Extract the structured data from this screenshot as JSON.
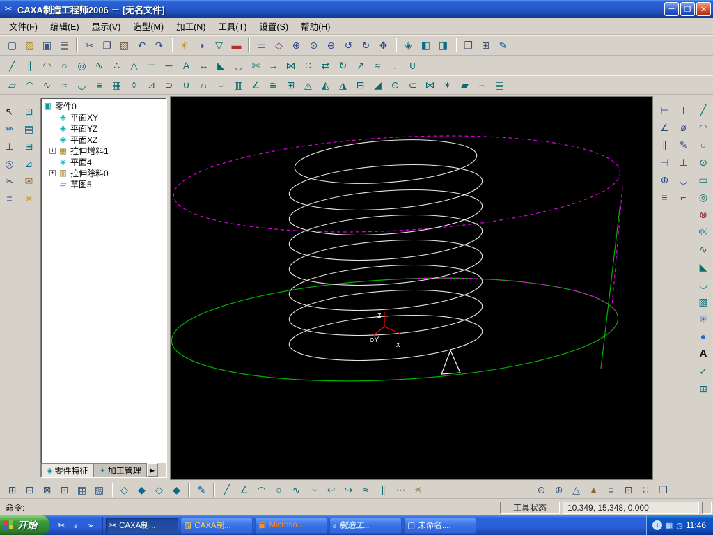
{
  "window": {
    "title": "CAXA制造工程师2006  －  [无名文件]",
    "app_icon": "✂",
    "controls": {
      "minimize": "─",
      "restore": "❐",
      "close": "✕"
    }
  },
  "menu": {
    "items": [
      {
        "name": "menu-file",
        "label": "文件(F)"
      },
      {
        "name": "menu-edit",
        "label": "编辑(E)"
      },
      {
        "name": "menu-view",
        "label": "显示(V)"
      },
      {
        "name": "menu-model",
        "label": "造型(M)"
      },
      {
        "name": "menu-machining",
        "label": "加工(N)"
      },
      {
        "name": "menu-tools",
        "label": "工具(T)"
      },
      {
        "name": "menu-settings",
        "label": "设置(S)"
      },
      {
        "name": "menu-help",
        "label": "帮助(H)"
      }
    ]
  },
  "toolbars": {
    "standard": [
      {
        "name": "new-icon",
        "g": "▢",
        "c": "#35567a"
      },
      {
        "name": "open-icon",
        "g": "▨",
        "c": "#a8802a"
      },
      {
        "name": "save-icon",
        "g": "▣",
        "c": "#35567a"
      },
      {
        "name": "print-icon",
        "g": "▤",
        "c": "#5a5a66"
      },
      {
        "cls": "sep",
        "g": ""
      },
      {
        "name": "cut-icon",
        "g": "✂",
        "c": "#44506a"
      },
      {
        "name": "copy-icon",
        "g": "❐",
        "c": "#44506a"
      },
      {
        "name": "paste-icon",
        "g": "▧",
        "c": "#7a5a3a"
      },
      {
        "name": "undo-icon",
        "g": "↶",
        "c": "#2a4a9a"
      },
      {
        "name": "redo-icon",
        "g": "↷",
        "c": "#2a4a9a"
      },
      {
        "cls": "sep",
        "g": ""
      },
      {
        "name": "render-mode-icon",
        "g": "☀",
        "c": "#c09020"
      },
      {
        "name": "wireframe-mode-icon",
        "g": "◑",
        "c": "#2a4a9a"
      },
      {
        "name": "filter-icon",
        "g": "▽",
        "c": "#0a7a6a"
      },
      {
        "name": "color-palette-icon",
        "g": "▬",
        "c": "#b03030"
      },
      {
        "cls": "sep",
        "g": ""
      },
      {
        "name": "redraw-icon",
        "g": "▭",
        "c": "#2a4a9a"
      },
      {
        "name": "dynamic-rotate-icon",
        "g": "◇",
        "c": "#8a2a8a"
      },
      {
        "name": "zoom-in-icon",
        "g": "⊕",
        "c": "#2a4a9a"
      },
      {
        "name": "zoom-window-icon",
        "g": "⊙",
        "c": "#2a4a9a"
      },
      {
        "name": "zoom-out-icon",
        "g": "⊖",
        "c": "#2a4a9a"
      },
      {
        "name": "rotate-ccw-icon",
        "g": "↺",
        "c": "#2a4a9a"
      },
      {
        "name": "rotate-cw-icon",
        "g": "↻",
        "c": "#2a4a9a"
      },
      {
        "name": "pan-icon",
        "g": "✥",
        "c": "#2a4a9a"
      },
      {
        "cls": "sep",
        "g": ""
      },
      {
        "name": "iso-view-icon",
        "g": "◈",
        "c": "#0a6a8a"
      },
      {
        "name": "front-view-icon",
        "g": "◧",
        "c": "#0a6a8a"
      },
      {
        "name": "top-view-icon",
        "g": "◨",
        "c": "#0a6a8a"
      },
      {
        "cls": "sep",
        "g": ""
      },
      {
        "name": "new-window-icon",
        "g": "❒",
        "c": "#44506a"
      },
      {
        "name": "tile-window-icon",
        "g": "⊞",
        "c": "#44506a"
      },
      {
        "name": "sketch-icon",
        "g": "✎",
        "c": "#0a5aa0"
      }
    ],
    "curves": [
      {
        "name": "line-icon",
        "g": "╱"
      },
      {
        "name": "parallel-line-icon",
        "g": "∥"
      },
      {
        "name": "arc-icon",
        "g": "◠"
      },
      {
        "name": "circle-icon",
        "g": "○"
      },
      {
        "name": "ellipse-icon",
        "g": "◎"
      },
      {
        "name": "spline-icon",
        "g": "∿"
      },
      {
        "name": "point-icon",
        "g": "∴"
      },
      {
        "name": "polygon-icon",
        "g": "△"
      },
      {
        "name": "rectangle-icon",
        "g": "▭"
      },
      {
        "name": "centerline-icon",
        "g": "┼"
      },
      {
        "name": "text-icon",
        "g": "A"
      },
      {
        "name": "dimension-icon",
        "g": "↔"
      },
      {
        "name": "chamfer-icon",
        "g": "◣"
      },
      {
        "name": "fillet-icon",
        "g": "◡"
      },
      {
        "name": "trim-icon",
        "g": "✄"
      },
      {
        "name": "extend-icon",
        "g": "→"
      },
      {
        "name": "mirror-icon",
        "g": "⋈"
      },
      {
        "name": "array-icon",
        "g": "∷"
      },
      {
        "name": "translate-icon",
        "g": "⇄"
      },
      {
        "name": "rotate-icon",
        "g": "↻"
      },
      {
        "name": "scale-icon",
        "g": "↗"
      },
      {
        "name": "offset-icon",
        "g": "≈"
      },
      {
        "name": "project-icon",
        "g": "↓"
      },
      {
        "name": "combine-icon",
        "g": "∪"
      }
    ],
    "surfaces": [
      {
        "name": "ruled-surface-icon",
        "g": "▱"
      },
      {
        "name": "revolved-surface-icon",
        "g": "◠"
      },
      {
        "name": "swept-surface-icon",
        "g": "∿"
      },
      {
        "name": "lofted-surface-icon",
        "g": "≈"
      },
      {
        "name": "boundary-surface-icon",
        "g": "◡"
      },
      {
        "name": "offset-surface-icon",
        "g": "≡"
      },
      {
        "name": "mesh-surface-icon",
        "g": "▦"
      },
      {
        "name": "patch-surface-icon",
        "g": "◊"
      },
      {
        "name": "trim-surface-icon",
        "g": "⊿"
      },
      {
        "name": "extend-surface-icon",
        "g": "⊃"
      },
      {
        "name": "stitch-surface-icon",
        "g": "∪"
      },
      {
        "name": "fillet-surface-icon",
        "g": "∩"
      },
      {
        "name": "blend-surface-icon",
        "g": "⌣"
      },
      {
        "name": "planar-surface-icon",
        "g": "▥"
      },
      {
        "name": "angle-surface-icon",
        "g": "∠"
      },
      {
        "name": "compare-surface-icon",
        "g": "≅"
      },
      {
        "name": "extrude-icon",
        "g": "⊞"
      },
      {
        "name": "revolve-solid-icon",
        "g": "◬"
      },
      {
        "name": "sweep-solid-icon",
        "g": "◭"
      },
      {
        "name": "loft-solid-icon",
        "g": "◮"
      },
      {
        "name": "shell-icon",
        "g": "⊟"
      },
      {
        "name": "draft-icon",
        "g": "◢"
      },
      {
        "name": "hole-icon",
        "g": "⊙"
      },
      {
        "name": "rib-icon",
        "g": "⊂"
      },
      {
        "name": "pattern-icon",
        "g": "⋈"
      },
      {
        "name": "boolean-icon",
        "g": "✶"
      },
      {
        "name": "thicken-icon",
        "g": "▰"
      },
      {
        "name": "split-icon",
        "g": "⌢"
      },
      {
        "name": "curve-mesh-icon",
        "g": "▤"
      }
    ],
    "left": [
      {
        "name": "select-icon",
        "g": "↖",
        "c": "#222222"
      },
      {
        "name": "sketch-plane-icon",
        "g": "⊡",
        "c": "#0a6a8a"
      },
      {
        "name": "draw-curve-icon",
        "g": "✏",
        "c": "#0a5aa0"
      },
      {
        "name": "feature-list-icon",
        "g": "▤",
        "c": "#0a6a8a"
      },
      {
        "name": "coord-system-icon",
        "g": "⊥",
        "c": "#8a2a2a"
      },
      {
        "name": "grid-icon",
        "g": "⊞",
        "c": "#0a6a8a"
      },
      {
        "name": "snap-icon",
        "g": "◎",
        "c": "#2a4a9a"
      },
      {
        "name": "measure-icon",
        "g": "⊿",
        "c": "#0a6a8a"
      },
      {
        "name": "scissors-icon",
        "g": "✂",
        "c": "#44506a"
      },
      {
        "name": "mail-icon",
        "g": "✉",
        "c": "#8a6a2a"
      },
      {
        "name": "layer-icon",
        "g": "≡",
        "c": "#2a4a9a"
      },
      {
        "name": "macro-icon",
        "g": "✳",
        "c": "#c08a10"
      }
    ],
    "right_inner": [
      {
        "name": "dim-horizontal-icon",
        "g": "⊢"
      },
      {
        "name": "dim-vertical-icon",
        "g": "⊤"
      },
      {
        "name": "dim-angle-icon",
        "g": "∠"
      },
      {
        "name": "dim-radius-icon",
        "g": "ø"
      },
      {
        "name": "dim-align-icon",
        "g": "∥"
      },
      {
        "name": "dim-edit-icon",
        "g": "✎"
      },
      {
        "name": "constrain-h-icon",
        "g": "⊣"
      },
      {
        "name": "constrain-v-icon",
        "g": "⊥"
      },
      {
        "name": "constrain-fix-icon",
        "g": "⊕"
      },
      {
        "name": "constrain-tangent-icon",
        "g": "◡"
      },
      {
        "name": "constrain-parallel-icon",
        "g": "≡"
      },
      {
        "name": "constrain-perp-icon",
        "g": "⌐"
      }
    ],
    "right_outer": [
      {
        "name": "line-tool-icon",
        "g": "╱"
      },
      {
        "name": "arc-tool-icon",
        "g": "◠"
      },
      {
        "name": "circle-tool-icon",
        "g": "○"
      },
      {
        "name": "point-tool-icon",
        "g": "⊙"
      },
      {
        "name": "rect-tool-icon",
        "g": "▭"
      },
      {
        "name": "ellipse-tool-icon",
        "g": "◎"
      },
      {
        "name": "erase-icon",
        "g": "⊗",
        "c": "#8a2a2a"
      },
      {
        "name": "formula-curve-icon",
        "g": "f(x)",
        "cls": "fx"
      },
      {
        "name": "spline-tool-icon",
        "g": "∿"
      },
      {
        "name": "chamfer-tool-icon",
        "g": "◣"
      },
      {
        "name": "fillet-tool-icon",
        "g": "◡"
      },
      {
        "name": "hatch-icon",
        "g": "▨"
      },
      {
        "name": "spray-icon",
        "g": "✳",
        "c": "#2a6ad0"
      },
      {
        "name": "droplet-icon",
        "g": "●",
        "c": "#2a6ad0"
      },
      {
        "name": "text-tool-icon",
        "g": "A",
        "c": "#111111",
        "cls": "bold"
      },
      {
        "name": "check-icon",
        "g": "✓",
        "c": "#0a7a2a"
      },
      {
        "name": "pattern-grid-icon",
        "g": "⊞"
      }
    ],
    "bottom": [
      {
        "name": "view-front-icon",
        "g": "⊞",
        "c": "#35567a"
      },
      {
        "name": "view-back-icon",
        "g": "⊟",
        "c": "#35567a"
      },
      {
        "name": "view-left-icon",
        "g": "⊠",
        "c": "#35567a"
      },
      {
        "name": "view-right-icon",
        "g": "⊡",
        "c": "#35567a"
      },
      {
        "name": "view-top-icon",
        "g": "▦",
        "c": "#35567a"
      },
      {
        "name": "view-iso-icon",
        "g": "▧",
        "c": "#35567a"
      },
      {
        "cls": "sep",
        "g": ""
      },
      {
        "name": "plane-xy-icon",
        "g": "◇",
        "c": "#0a6a8a"
      },
      {
        "name": "plane-yz-icon",
        "g": "◆",
        "c": "#0a6a8a"
      },
      {
        "name": "plane-xz-icon",
        "g": "◇",
        "c": "#0a6a8a"
      },
      {
        "name": "plane-3pt-icon",
        "g": "◆",
        "c": "#0a6a8a"
      },
      {
        "cls": "sep",
        "g": ""
      },
      {
        "name": "sketch-pencil-icon",
        "g": "✎",
        "c": "#0a5aa0"
      },
      {
        "cls": "sep",
        "g": ""
      },
      {
        "name": "sk-line-icon",
        "g": "╱",
        "c": "#0a6a72"
      },
      {
        "name": "sk-angle-icon",
        "g": "∠",
        "c": "#0a6a72"
      },
      {
        "name": "sk-arc-icon",
        "g": "◠",
        "c": "#0a6a72"
      },
      {
        "name": "sk-circle-icon",
        "g": "○",
        "c": "#0a6a72"
      },
      {
        "name": "sk-spline-icon",
        "g": "∿",
        "c": "#0a6a72"
      },
      {
        "name": "sk-wave-icon",
        "g": "∼",
        "c": "#0a6a72"
      },
      {
        "name": "sk-hook-left-icon",
        "g": "↩",
        "c": "#0a6a72"
      },
      {
        "name": "sk-hook-right-icon",
        "g": "↪",
        "c": "#0a6a72"
      },
      {
        "name": "sk-offset-icon",
        "g": "≈",
        "c": "#0a6a72"
      },
      {
        "name": "sk-parallel-icon",
        "g": "∥",
        "c": "#0a6a72"
      },
      {
        "name": "sk-dots-icon",
        "g": "⋯",
        "c": "#444444"
      },
      {
        "name": "sk-star-icon",
        "g": "✳",
        "c": "#8a6a2a"
      },
      {
        "cls": "gap",
        "g": ""
      },
      {
        "name": "hole-axis-icon",
        "g": "⊙",
        "c": "#35567a"
      },
      {
        "name": "target-icon",
        "g": "⊕",
        "c": "#35567a"
      },
      {
        "name": "cone-icon",
        "g": "△",
        "c": "#35567a"
      },
      {
        "name": "warn-icon",
        "g": "▲",
        "c": "#8a6a2a"
      },
      {
        "name": "list-icon",
        "g": "≡",
        "c": "#35567a"
      },
      {
        "name": "cube-icon",
        "g": "⊡",
        "c": "#35567a"
      },
      {
        "name": "array-grid-icon",
        "g": "∷",
        "c": "#35567a"
      },
      {
        "name": "window-cascade-icon",
        "g": "❒",
        "c": "#35567a"
      }
    ]
  },
  "tree": {
    "items": [
      {
        "name": "tree-item-part0",
        "label": "零件0",
        "cls": "lv0 i-part",
        "ig": "▣",
        "exp": ""
      },
      {
        "name": "tree-item-plane-xy",
        "label": "平面XY",
        "cls": "lv1 i-plane",
        "ig": "◈",
        "exp": ""
      },
      {
        "name": "tree-item-plane-yz",
        "label": "平面YZ",
        "cls": "lv1 i-plane",
        "ig": "◈",
        "exp": ""
      },
      {
        "name": "tree-item-plane-xz",
        "label": "平面XZ",
        "cls": "lv1 i-plane",
        "ig": "◈",
        "exp": ""
      },
      {
        "name": "tree-item-extrude-add1",
        "label": "拉伸增料1",
        "cls": "lv1 i-feat",
        "ig": "▦",
        "exp": "+"
      },
      {
        "name": "tree-item-plane4",
        "label": "平面4",
        "cls": "lv1 i-plane",
        "ig": "◈",
        "exp": ""
      },
      {
        "name": "tree-item-extrude-cut0",
        "label": "拉伸除料0",
        "cls": "lv1 i-feat",
        "ig": "▥",
        "exp": "+"
      },
      {
        "name": "tree-item-sketch5",
        "label": "草图5",
        "cls": "lv1 i-sketch",
        "ig": "▱",
        "exp": ""
      }
    ],
    "tabs": [
      {
        "name": "tab-part-features",
        "label": "零件特征",
        "g": "◈",
        "cls": "active"
      },
      {
        "name": "tab-machining",
        "label": "加工管理",
        "g": "✦"
      }
    ],
    "scroll_right": "▶"
  },
  "viewport": {
    "axes": {
      "z": "z",
      "o": "oY",
      "x": "x"
    }
  },
  "statusbar": {
    "command_label": "命令:",
    "tool_status": "工具状态",
    "coords": "10.349, 15.348, 0.000"
  },
  "taskbar": {
    "start": "开始",
    "quicklaunch": [
      {
        "name": "quicklaunch-caxa-icon",
        "g": "✂",
        "c": "#ffffdd"
      },
      {
        "name": "quicklaunch-ie-icon",
        "g": "e",
        "c": "#cfe1ff",
        "cls": "ie"
      },
      {
        "name": "quicklaunch-expand-icon",
        "g": "»",
        "c": "#ffffff"
      }
    ],
    "tasks": [
      {
        "name": "task-caxa-active",
        "label": "CAXA制...",
        "g": "✂",
        "c": "#ffffee",
        "cls": "active"
      },
      {
        "name": "task-caxa-folder",
        "label": "CAXA制...",
        "g": "▨",
        "c": "#ffd24a"
      },
      {
        "name": "task-microsoft",
        "label": "Microso...",
        "g": "▣",
        "c": "#ff8a2a"
      },
      {
        "name": "task-ie-page",
        "label": "制造工...",
        "g": "e",
        "c": "#bfe0ff",
        "cls": "ie"
      },
      {
        "name": "task-untitled",
        "label": "未命名....",
        "g": "▢",
        "c": "#eef4ff"
      }
    ],
    "tray": {
      "chevron": "‹",
      "input_icon": "▦",
      "clock_glyph": "◷"
    },
    "clock": "11:46"
  }
}
